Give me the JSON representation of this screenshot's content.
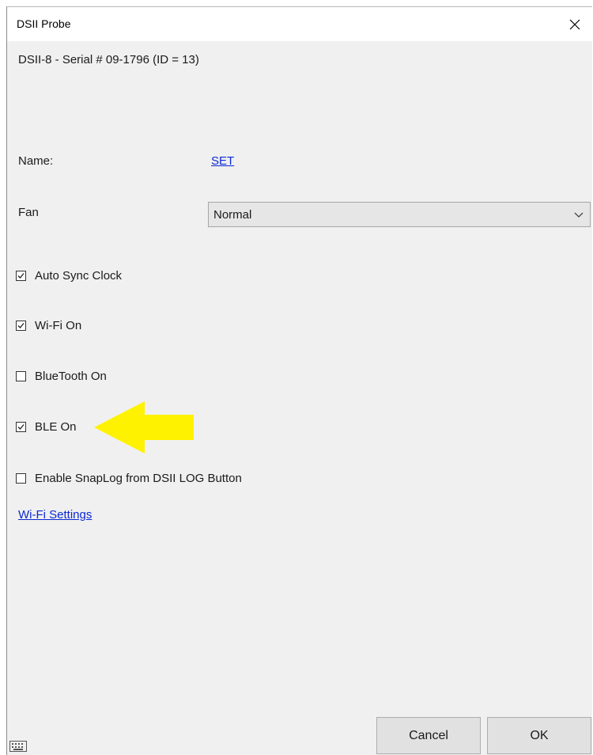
{
  "window": {
    "title": "DSII Probe",
    "close_glyph": "✕"
  },
  "device": {
    "serial_text": "DSII-8 - Serial # 09-1796 (ID = 13)"
  },
  "name_row": {
    "label": "Name:",
    "link_text": "SET"
  },
  "fan": {
    "label": "Fan",
    "selected": "Normal"
  },
  "checkboxes": [
    {
      "label": "Auto Sync Clock",
      "checked": true
    },
    {
      "label": "Wi-Fi On",
      "checked": true
    },
    {
      "label": "BlueTooth On",
      "checked": false
    },
    {
      "label": "BLE On",
      "checked": true
    },
    {
      "label": "Enable SnapLog from DSII LOG Button",
      "checked": false
    }
  ],
  "wifi_settings_link": "Wi-Fi Settings",
  "buttons": {
    "cancel": "Cancel",
    "ok": "OK"
  },
  "colors": {
    "link": "#0b29d4",
    "annotation_arrow": "#fff200",
    "dialog_bg": "#f0f0f0"
  },
  "icons": {
    "close": "close-icon",
    "dropdown": "chevron-down-icon",
    "check": "checkmark-icon",
    "keyboard": "keyboard-icon",
    "annotation": "left-arrow-icon"
  }
}
